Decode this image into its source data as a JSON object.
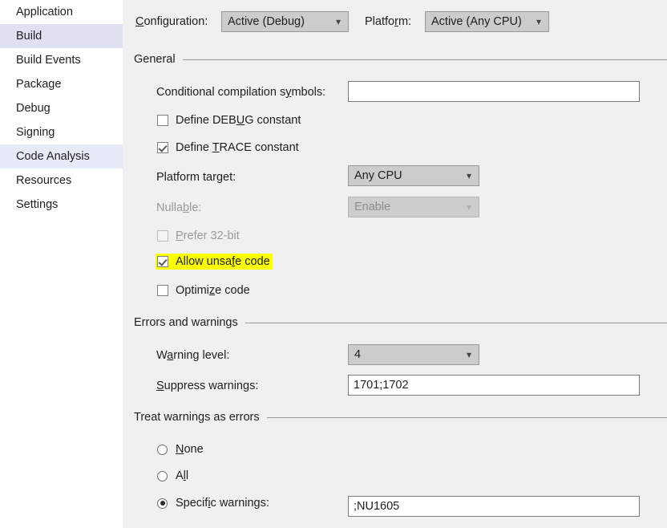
{
  "sidebar": {
    "items": [
      {
        "label": "Application",
        "state": "normal"
      },
      {
        "label": "Build",
        "state": "selected"
      },
      {
        "label": "Build Events",
        "state": "normal"
      },
      {
        "label": "Package",
        "state": "normal"
      },
      {
        "label": "Debug",
        "state": "normal"
      },
      {
        "label": "Signing",
        "state": "normal"
      },
      {
        "label": "Code Analysis",
        "state": "hovered"
      },
      {
        "label": "Resources",
        "state": "normal"
      },
      {
        "label": "Settings",
        "state": "normal"
      }
    ]
  },
  "toolbar": {
    "configuration_label": "Configuration:",
    "configuration_value": "Active (Debug)",
    "platform_label": "Platform:",
    "platform_value": "Active (Any CPU)",
    "chevron_icon": "chevron-down-icon"
  },
  "general": {
    "header": "General",
    "conditional_symbols_label": "Conditional compilation symbols:",
    "conditional_symbols_value": "",
    "define_debug_label": "Define DEBUG constant",
    "define_debug_checked": "unchecked",
    "define_trace_label": "Define TRACE constant",
    "define_trace_checked": "checked",
    "platform_target_label": "Platform target:",
    "platform_target_value": "Any CPU",
    "nullable_label": "Nullable:",
    "nullable_value": "Enable",
    "prefer32_label": "Prefer 32-bit",
    "allow_unsafe_label": "Allow unsafe code",
    "allow_unsafe_checked": "checked",
    "optimize_label": "Optimize code",
    "optimize_checked": "unchecked"
  },
  "errors_warnings": {
    "header": "Errors and warnings",
    "warning_level_label": "Warning level:",
    "warning_level_value": "4",
    "suppress_label": "Suppress warnings:",
    "suppress_value": "1701;1702"
  },
  "treat_warnings": {
    "header": "Treat warnings as errors",
    "none_label": "None",
    "all_label": "All",
    "specific_label": "Specific warnings:",
    "specific_value": ";NU1605",
    "selected": "specific"
  },
  "colors": {
    "panel_bg": "#f0f0f0",
    "sidebar_bg": "#ffffff",
    "selected_item_bg": "#dfe1f3",
    "hovered_item_bg": "#e7ebf8",
    "highlight": "#fbff00",
    "rule": "#9a9a9a"
  }
}
